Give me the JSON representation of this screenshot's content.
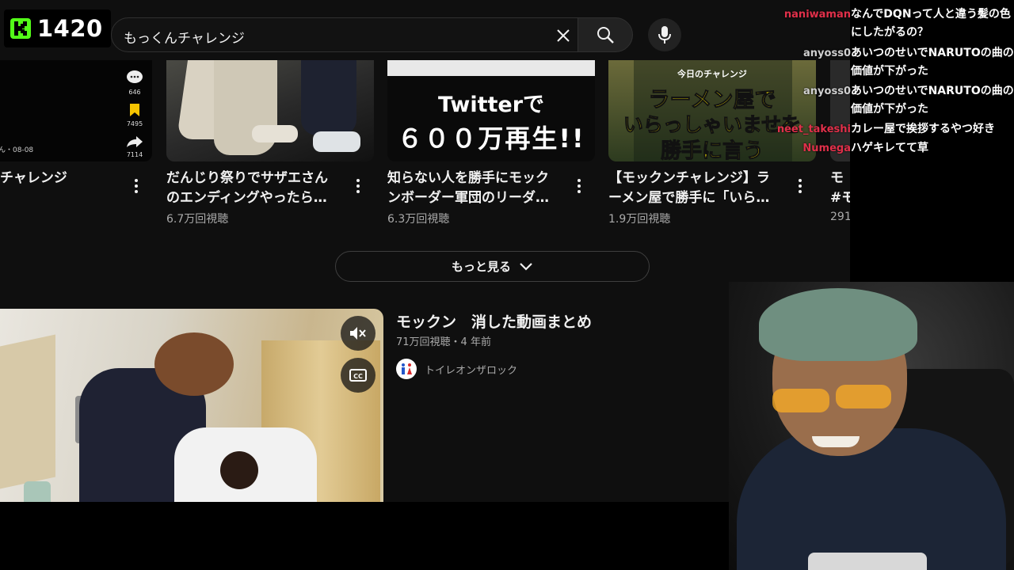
{
  "search": {
    "query": "もっくんチャレンジ"
  },
  "counter": {
    "viewers": "1420"
  },
  "shorts": [
    {
      "title_line1": "チャレンジ",
      "stat_comments": "646",
      "stat_saves": "7495",
      "stat_shares": "7114",
      "channel_date": "ん・08-08"
    },
    {
      "title_line1": "だんじり祭りでサザエさん",
      "title_line2": "のエンディングやったら…",
      "views": "6.7万回視聴"
    },
    {
      "title_line1": "知らない人を勝手にモック",
      "title_line2": "ンボーダー軍団のリーダ…",
      "views": "6.3万回視聴",
      "thumb_text_1": "Twitterで",
      "thumb_text_2": "６００万再生!!"
    },
    {
      "title_line1": "【モックンチャレンジ】ラ",
      "title_line2": "ーメン屋で勝手に「いら…",
      "views": "1.9万回視聴",
      "thumb_small": "今日のチャレンジ",
      "thumb_line1": "ラーメン屋で",
      "thumb_line2": "いらっしゃいませを",
      "thumb_line3": "勝手に言う"
    },
    {
      "title_line1": "モ",
      "title_line2": "#モ",
      "views": "291"
    }
  ],
  "more_button": {
    "label": "もっと見る"
  },
  "video": {
    "title": "モックン　消した動画まとめ",
    "meta": "71万回視聴・4 年前",
    "channel": "トイレオンザロック"
  },
  "chat": [
    {
      "user": "naniwaman",
      "text": "なんでDQNって人と違う髪の色にしたがるの？",
      "user_color": "#e0304a"
    },
    {
      "user": "anyoss0",
      "text": "あいつのせいでNARUTOの曲の価値が下がった",
      "user_color": "#d0d0d0"
    },
    {
      "user": "anyoss0",
      "text": "あいつのせいでNARUTOの曲の価値が下がった",
      "user_color": "#d0d0d0"
    },
    {
      "user": "neet_takeshi",
      "text": "カレー屋で挨拶するやつ好き",
      "user_color": "#e0304a"
    },
    {
      "user": "Numega",
      "text": "ハゲキレてて草",
      "user_color": "#e0304a"
    }
  ],
  "colors": {
    "background": "#0f0f0f",
    "text": "#f1f1f1",
    "muted": "#aaaaaa",
    "kick_green": "#53fc18",
    "thumb_yellow": "#f6e400"
  }
}
